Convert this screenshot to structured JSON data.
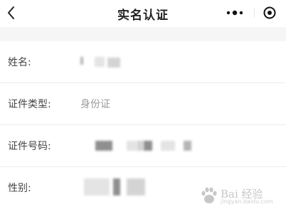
{
  "navbar": {
    "title": "实名认证",
    "back_icon": "chevron-left-icon",
    "more_icon": "more-dots-icon",
    "close_icon": "target-close-icon"
  },
  "form": {
    "name": {
      "label": "姓名:",
      "value_masked": true
    },
    "id_type": {
      "label": "证件类型:",
      "value": "身份证"
    },
    "id_number": {
      "label": "证件号码:",
      "value_masked": true
    },
    "gender": {
      "label": "性别:",
      "value_masked": true
    }
  },
  "watermark": {
    "text": "Bai 经验",
    "url": "jingyan.baidu.com"
  }
}
